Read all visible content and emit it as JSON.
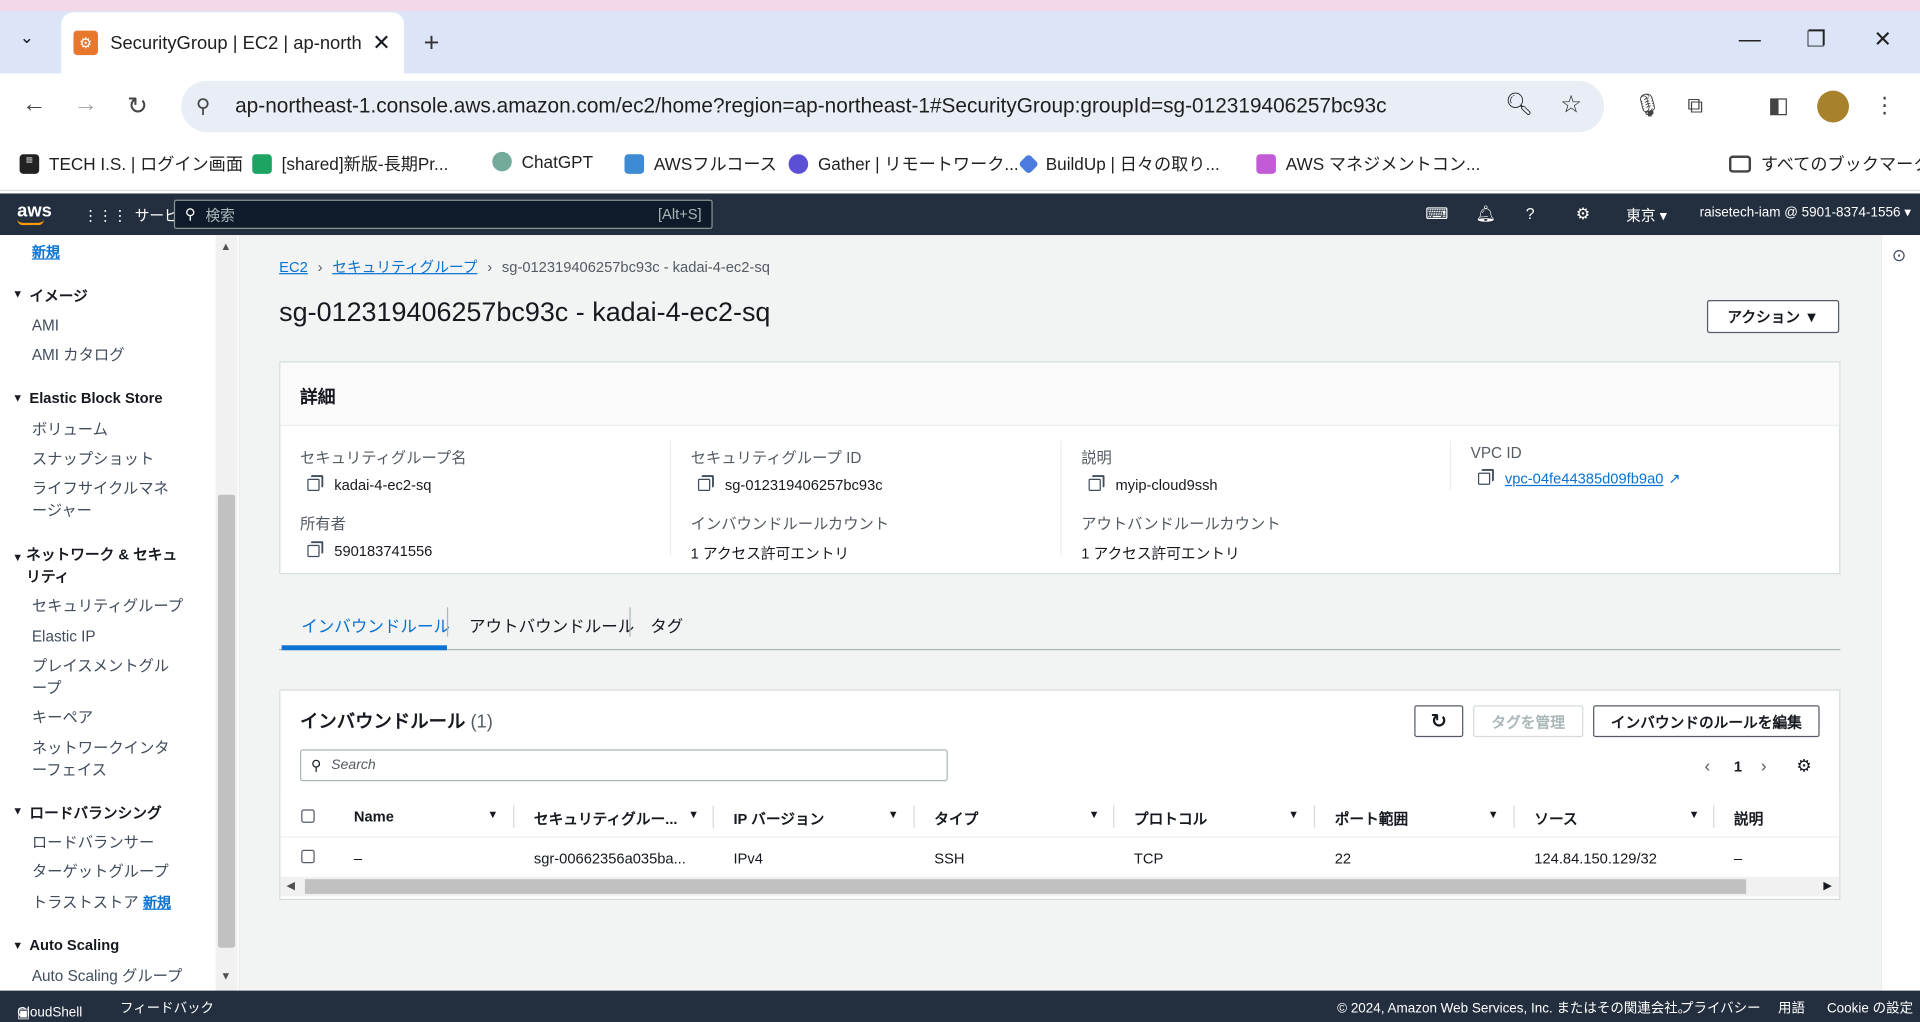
{
  "browser": {
    "tab_title": "SecurityGroup | EC2 | ap-northe",
    "url": "ap-northeast-1.console.aws.amazon.com/ec2/home?region=ap-northeast-1#SecurityGroup:groupId=sg-012319406257bc93c",
    "bookmarks": [
      "TECH I.S. | ログイン画面",
      "[shared]新版-長期Pr...",
      "ChatGPT",
      "AWSフルコース",
      "Gather | リモートワーク...",
      "BuildUp | 日々の取り...",
      "AWS マネジメントコン..."
    ],
    "all_bookmarks": "すべてのブックマーク"
  },
  "awsbar": {
    "logo": "aws",
    "services": "サービス",
    "search_placeholder": "検索",
    "search_shortcut": "[Alt+S]",
    "region": "東京",
    "account": "raisetech-iam @ 5901-8374-1556"
  },
  "sidebar": {
    "top_new": "新規",
    "sections": [
      {
        "title": "イメージ",
        "items": [
          "AMI",
          "AMI カタログ"
        ]
      },
      {
        "title": "Elastic Block Store",
        "items": [
          "ボリューム",
          "スナップショット",
          "ライフサイクルマネージャー"
        ]
      },
      {
        "title": "ネットワーク & セキュリティ",
        "items": [
          "セキュリティグループ",
          "Elastic IP",
          "プレイスメントグループ",
          "キーペア",
          "ネットワークインターフェイス"
        ]
      },
      {
        "title": "ロードバランシング",
        "items": [
          "ロードバランサー",
          "ターゲットグループ",
          "トラストストア"
        ]
      },
      {
        "title": "Auto Scaling",
        "items": [
          "Auto Scaling グループ"
        ]
      }
    ],
    "truststore_new": "新規"
  },
  "breadcrumb": [
    "EC2",
    "セキュリティグループ",
    "sg-012319406257bc93c - kadai-4-ec2-sq"
  ],
  "page_title": "sg-012319406257bc93c - kadai-4-ec2-sq",
  "actions_label": "アクション ▼",
  "details": {
    "header": "詳細",
    "sg_name_label": "セキュリティグループ名",
    "sg_name": "kadai-4-ec2-sq",
    "sg_id_label": "セキュリティグループ ID",
    "sg_id": "sg-012319406257bc93c",
    "desc_label": "説明",
    "desc": "myip-cloud9ssh",
    "vpc_label": "VPC ID",
    "vpc": "vpc-04fe44385d09fb9a0",
    "owner_label": "所有者",
    "owner": "590183741556",
    "inbound_count_label": "インバウンドルールカウント",
    "inbound_count": "1 アクセス許可エントリ",
    "outbound_count_label": "アウトバンドルールカウント",
    "outbound_count": "1 アクセス許可エントリ"
  },
  "tabs": [
    "インバウンドルール",
    "アウトバウンドルール",
    "タグ"
  ],
  "rules": {
    "title": "インバウンドルール",
    "count": "(1)",
    "manage_tags": "タグを管理",
    "edit_rules": "インバウンドのルールを編集",
    "search_placeholder": "Search",
    "page": "1",
    "columns": [
      "Name",
      "セキュリティグルー...",
      "IP バージョン",
      "タイプ",
      "プロトコル",
      "ポート範囲",
      "ソース",
      "説明"
    ],
    "row": [
      "–",
      "sgr-00662356a035ba...",
      "IPv4",
      "SSH",
      "TCP",
      "22",
      "124.84.150.129/32",
      "–"
    ]
  },
  "footer": {
    "cloudshell": "CloudShell",
    "feedback": "フィードバック",
    "copyright": "© 2024, Amazon Web Services, Inc. またはその関連会社。",
    "privacy": "プライバシー",
    "terms": "用語",
    "cookie": "Cookie の設定"
  }
}
